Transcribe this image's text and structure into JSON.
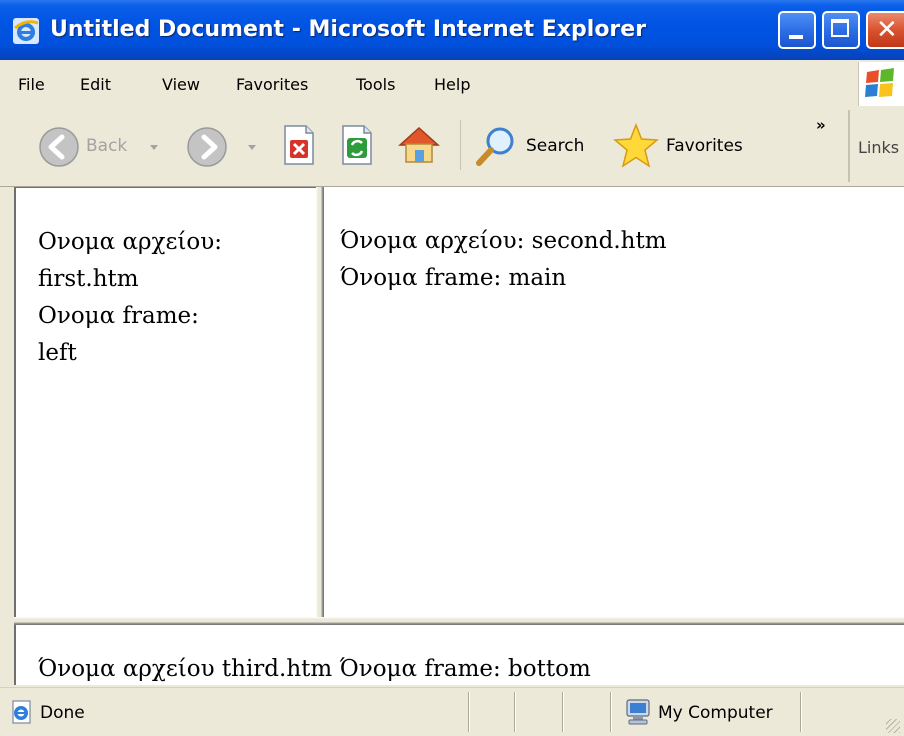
{
  "window": {
    "title": "Untitled Document - Microsoft Internet Explorer",
    "controls": [
      "minimize",
      "maximize",
      "close"
    ]
  },
  "menu": {
    "items": [
      {
        "label": "File"
      },
      {
        "label": "Edit"
      },
      {
        "label": "View"
      },
      {
        "label": "Favorites"
      },
      {
        "label": "Tools"
      },
      {
        "label": "Help"
      }
    ]
  },
  "toolbar": {
    "back_label": "Back",
    "search_label": "Search",
    "favorites_label": "Favorites",
    "chevron_label": "»",
    "links_label": "Links",
    "icons": [
      "back-arrow-icon",
      "forward-arrow-icon",
      "stop-icon",
      "refresh-icon",
      "home-icon",
      "search-magnifier-icon",
      "favorites-star-icon"
    ]
  },
  "frames": {
    "left": {
      "lines": [
        "Ονομα αρχείου:",
        "first.htm",
        "Ονομα frame:",
        "left"
      ]
    },
    "main": {
      "lines": [
        "Όνομα αρχείου: second.htm",
        "Όνομα frame: main"
      ]
    },
    "bottom": {
      "text": "Όνομα αρχείου third.htm Όνομα frame: bottom"
    }
  },
  "status": {
    "text": "Done",
    "zone": "My Computer"
  },
  "colors": {
    "titlebar": "#0054e3",
    "chrome": "#ece9d8",
    "close_button": "#d9532f"
  }
}
